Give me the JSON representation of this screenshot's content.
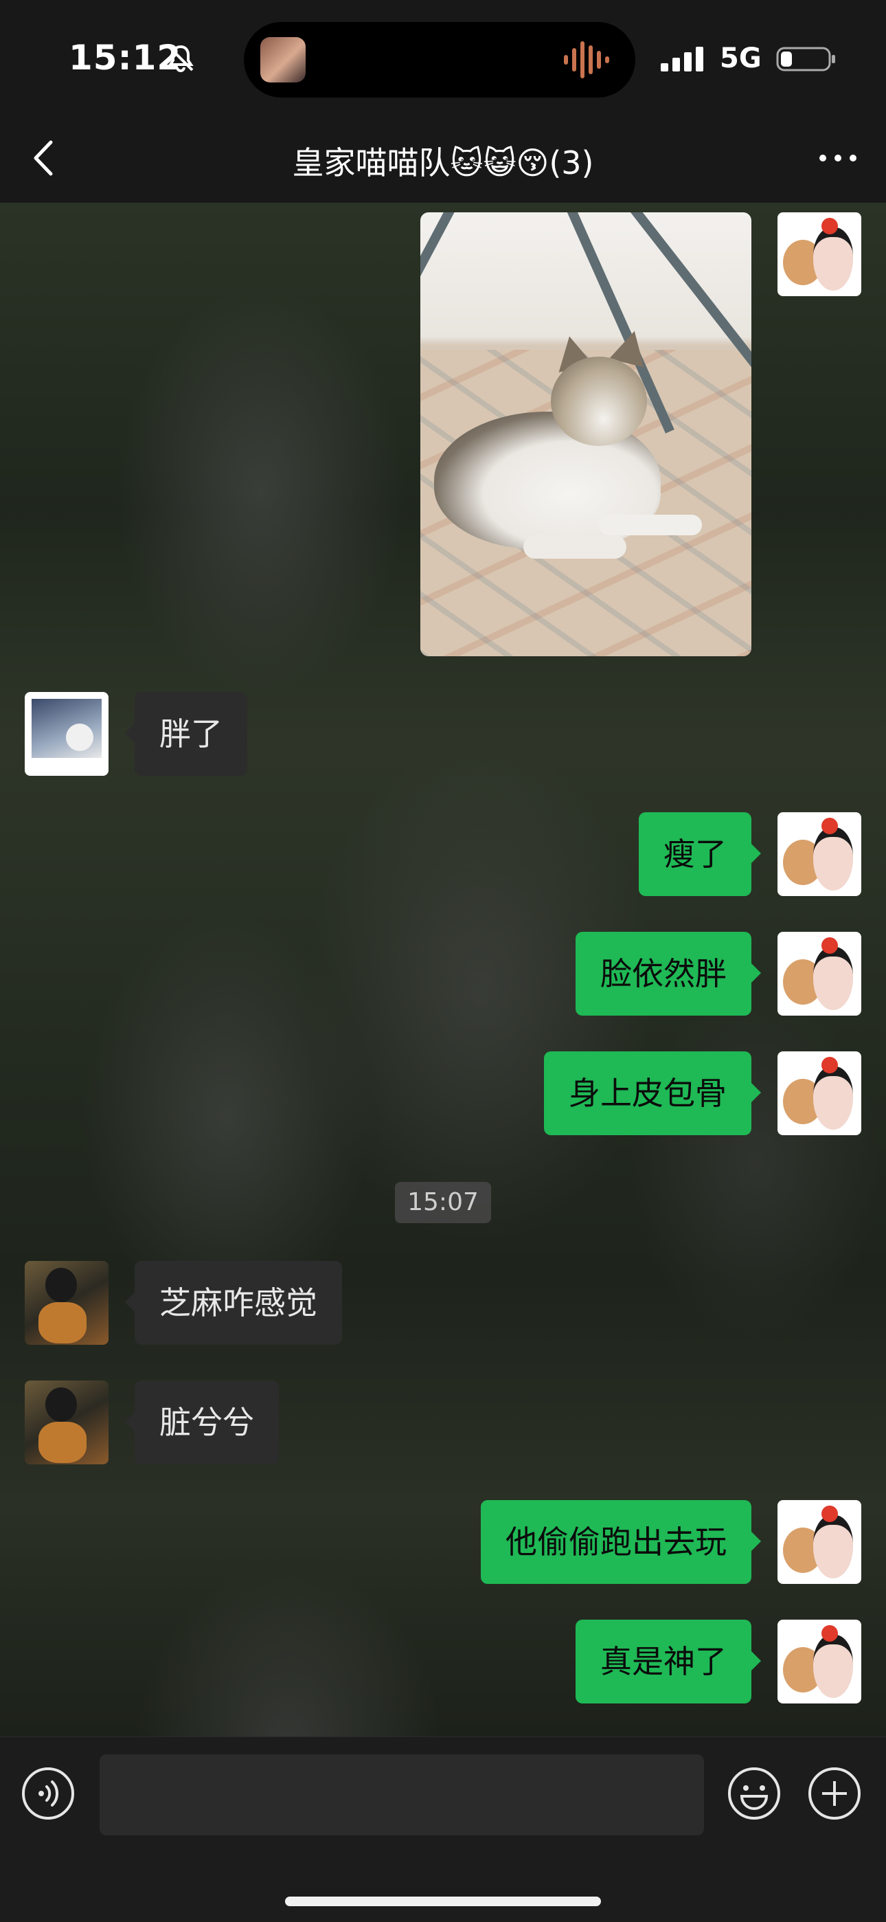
{
  "status_bar": {
    "time": "15:12",
    "network": "5G"
  },
  "header": {
    "title": "皇家喵喵队🐱😺😚(3)"
  },
  "messages": [
    {
      "side": "out",
      "kind": "image",
      "avatar": "self"
    },
    {
      "side": "in",
      "kind": "text",
      "text": "胖了",
      "avatar": "member-a"
    },
    {
      "side": "out",
      "kind": "text",
      "text": "瘦了",
      "avatar": "self"
    },
    {
      "side": "out",
      "kind": "text",
      "text": "脸依然胖",
      "avatar": "self"
    },
    {
      "side": "out",
      "kind": "text",
      "text": "身上皮包骨",
      "avatar": "self"
    },
    {
      "kind": "timestamp",
      "text": "15:07"
    },
    {
      "side": "in",
      "kind": "text",
      "text": "芝麻咋感觉",
      "avatar": "member-b"
    },
    {
      "side": "in",
      "kind": "text",
      "text": "脏兮兮",
      "avatar": "member-b"
    },
    {
      "side": "out",
      "kind": "text",
      "text": "他偷偷跑出去玩",
      "avatar": "self"
    },
    {
      "side": "out",
      "kind": "text",
      "text": "真是神了",
      "avatar": "self"
    }
  ],
  "colors": {
    "outgoing_bubble": "#1fb955",
    "incoming_bubble": "#2c2c2c",
    "background": "#181818"
  },
  "icons": [
    "muted-bell-icon",
    "waveform-icon",
    "signal-icon",
    "battery-icon",
    "back-icon",
    "more-icon",
    "voice-icon",
    "emoji-icon",
    "plus-icon"
  ]
}
